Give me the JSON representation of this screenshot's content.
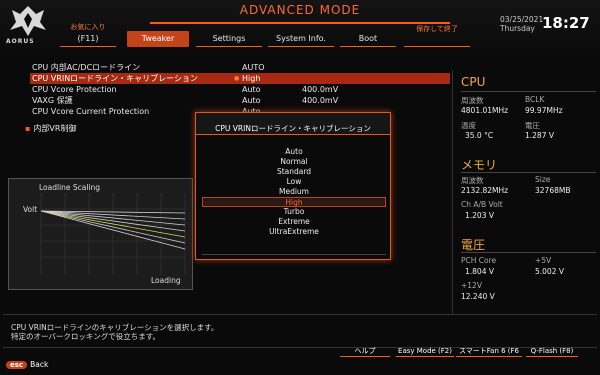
{
  "header": {
    "title": "ADVANCED MODE",
    "logo_text": "AORUS",
    "date": "03/25/2021",
    "day": "Thursday",
    "time": "18:27"
  },
  "tabs": [
    {
      "label": "お気に入り",
      "sub": "",
      "key": "(F11)"
    },
    {
      "label": "Tweaker"
    },
    {
      "label": "Settings"
    },
    {
      "label": "System Info."
    },
    {
      "label": "Boot"
    },
    {
      "label": "保存して終了"
    }
  ],
  "settings": [
    {
      "label": "CPU 内部AC/DCロードライン",
      "value": "AUTO",
      "value2": ""
    },
    {
      "label": "CPU VRINロードライン・キャリブレーション",
      "value": "High",
      "value2": ""
    },
    {
      "label": "CPU Vcore Protection",
      "value": "Auto",
      "value2": "400.0mV"
    },
    {
      "label": "VAXG 保護",
      "value": "Auto",
      "value2": "400.0mV"
    },
    {
      "label": "CPU Vcore Current Protection",
      "value": "Auto",
      "value2": ""
    }
  ],
  "submenu": {
    "label": "内部VR制御"
  },
  "graph": {
    "title": "Loadline Scaling",
    "y_label": "Volt",
    "x_label": "Loading"
  },
  "popup": {
    "title": "CPU VRINロードライン・キャリブレーション",
    "options": [
      "Auto",
      "Normal",
      "Standard",
      "Low",
      "Medium",
      "High",
      "Turbo",
      "Extreme",
      "UltraExtreme"
    ],
    "selected": "High"
  },
  "right_panel": {
    "cpu": {
      "title": "CPU",
      "freq_label": "周波数",
      "freq": "4801.01MHz",
      "bclk_label": "BCLK",
      "bclk": "99.97MHz",
      "temp_label": "温度",
      "temp": "35.0 °C",
      "volt_label": "電圧",
      "volt": "1.287 V"
    },
    "memory": {
      "title": "メモリ",
      "freq_label": "周波数",
      "freq": "2132.82MHz",
      "size_label": "Size",
      "size": "32768MB",
      "volt_label": "Ch A/B Volt",
      "volt": "1.203 V"
    },
    "voltage": {
      "title": "電圧",
      "pch_label": "PCH Core",
      "pch": "1.804 V",
      "p5_label": "+5V",
      "p5": "5.002 V",
      "p12_label": "+12V",
      "p12": "12.240 V"
    }
  },
  "help_text": [
    "CPU VRINロードラインのキャリブレーションを選択します。",
    "特定のオーバークロッキングで役立ちます。"
  ],
  "footer": {
    "help": "ヘルプ",
    "easy_mode": "Easy Mode (F2)",
    "smart_fan": "スマートFan 6 (F6",
    "qflash": "Q-Flash (F8)",
    "esc_key": "esc",
    "esc_label": "Back"
  },
  "colors": {
    "accent": "#ff5a1a",
    "highlight": "#a62a12",
    "gold": "#f3a83a"
  }
}
